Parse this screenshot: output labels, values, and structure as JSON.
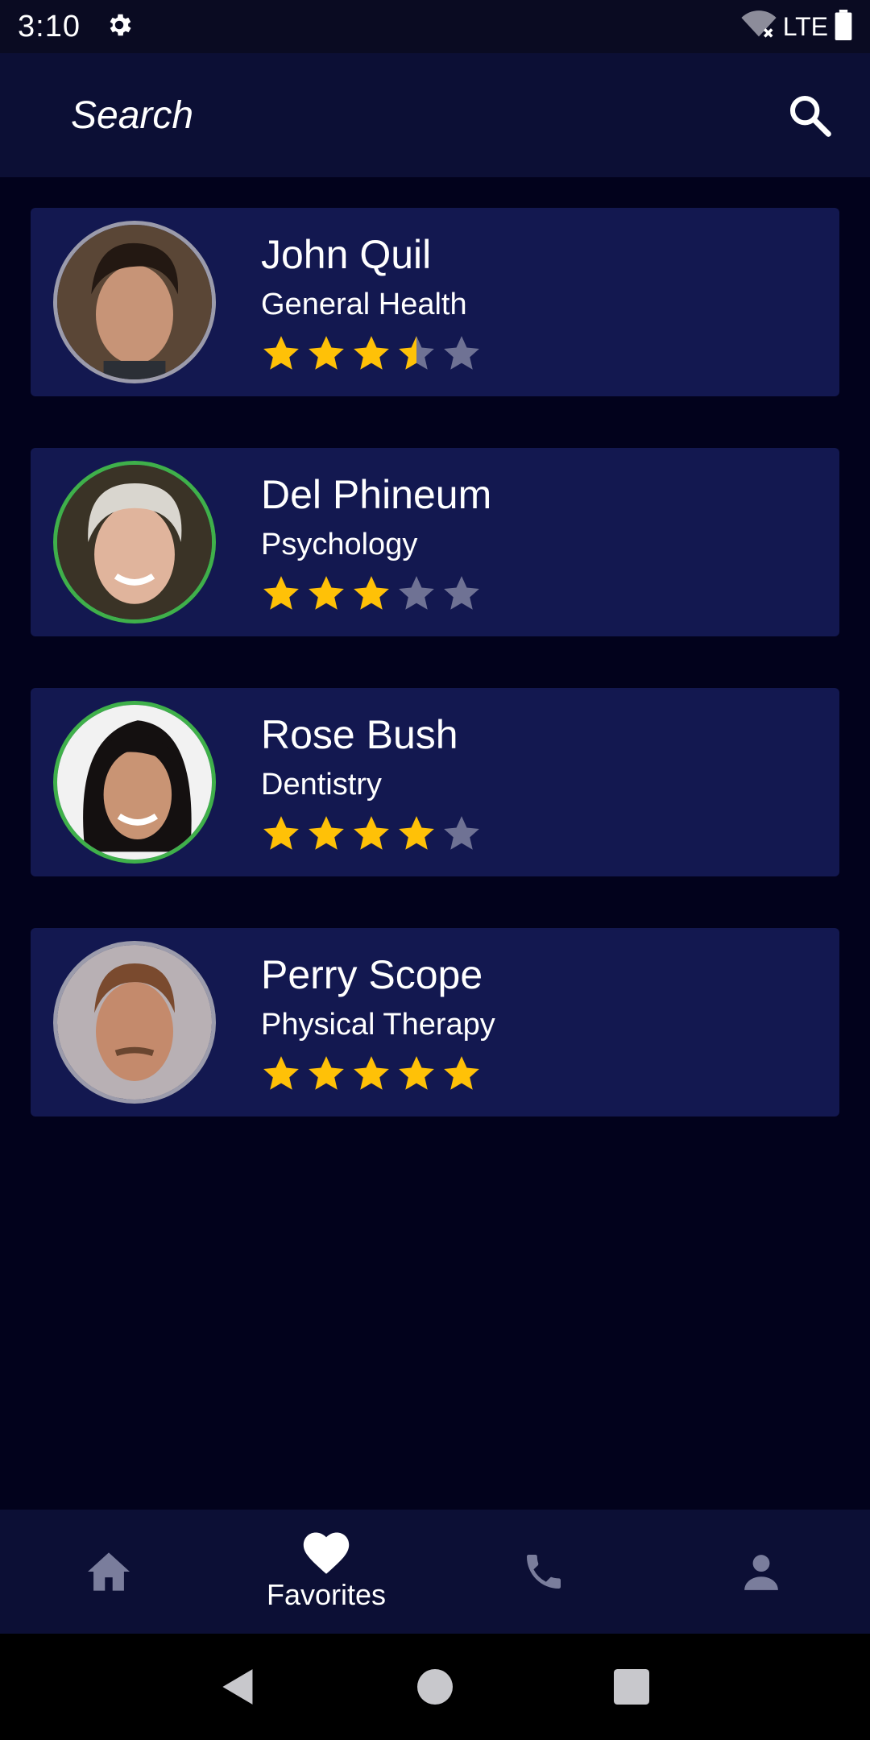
{
  "status_bar": {
    "time": "3:10",
    "network": "LTE",
    "icons": [
      "gear-icon",
      "wifi-off-icon",
      "battery-icon"
    ]
  },
  "search": {
    "placeholder": "Search",
    "icon": "search-icon"
  },
  "doctors": [
    {
      "name": "John Quil",
      "specialty": "General Health",
      "rating": 3.5,
      "online": false
    },
    {
      "name": "Del Phineum",
      "specialty": "Psychology",
      "rating": 3,
      "online": true
    },
    {
      "name": "Rose Bush",
      "specialty": "Dentistry",
      "rating": 4,
      "online": true
    },
    {
      "name": "Perry Scope",
      "specialty": "Physical Therapy",
      "rating": 5,
      "online": false
    }
  ],
  "bottom_nav": [
    {
      "icon": "home-icon",
      "label": ""
    },
    {
      "icon": "heart-icon",
      "label": "Favorites",
      "active": true
    },
    {
      "icon": "phone-icon",
      "label": ""
    },
    {
      "icon": "person-icon",
      "label": ""
    }
  ],
  "colors": {
    "background": "#02021c",
    "card": "#131850",
    "bar": "#0c0f35",
    "star_filled": "#ffc107",
    "star_empty": "#6f7294",
    "online_ring": "#3fb04a",
    "offline_ring": "#9b9bab",
    "nav_inactive": "#7a7d9c"
  }
}
